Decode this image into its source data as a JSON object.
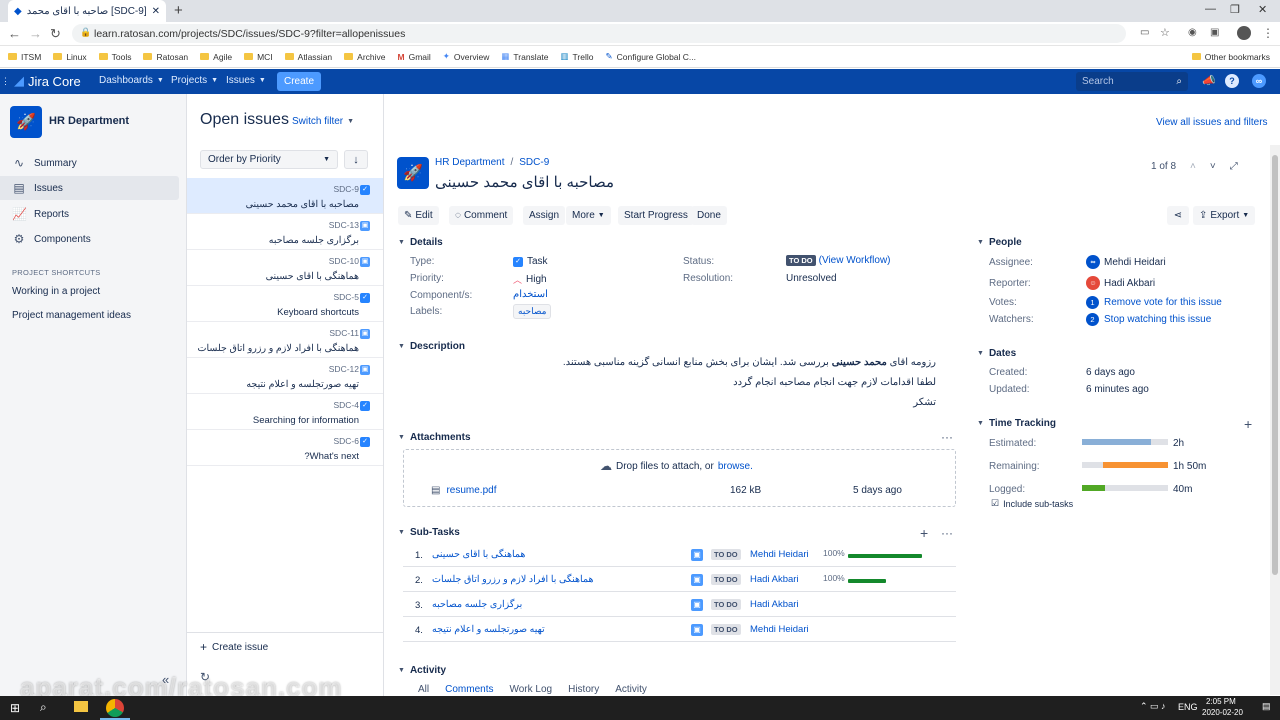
{
  "browser": {
    "tab_title": "[SDC-9] صاحبه با اقای محمد حسینی",
    "url": "learn.ratosan.com/projects/SDC/issues/SDC-9?filter=allopenissues",
    "bookmarks": [
      "ITSM",
      "Linux",
      "Tools",
      "Ratosan",
      "Agile",
      "MCI",
      "Atlassian",
      "Archive",
      "Gmail",
      "Overview",
      "Translate",
      "Trello",
      "Configure Global C..."
    ],
    "other_bookmarks": "Other bookmarks"
  },
  "jira_nav": {
    "logo": "Jira Core",
    "menus": [
      "Dashboards",
      "Projects",
      "Issues"
    ],
    "create": "Create",
    "search_placeholder": "Search"
  },
  "sidebar": {
    "project_name": "HR Department",
    "items": [
      {
        "label": "Summary",
        "icon": "pulse-icon"
      },
      {
        "label": "Issues",
        "icon": "issues-icon",
        "active": true
      },
      {
        "label": "Reports",
        "icon": "chart-icon"
      },
      {
        "label": "Components",
        "icon": "puzzle-icon"
      }
    ],
    "shortcuts_heading": "PROJECT SHORTCUTS",
    "shortcuts": [
      "Working in a project",
      "Project management ideas"
    ]
  },
  "issue_list": {
    "title": "Open issues",
    "switch_filter": "Switch filter",
    "order_by": "Order by Priority",
    "create_issue": "Create issue",
    "view_all": "View all issues and filters",
    "items": [
      {
        "key": "SDC-9",
        "summary": "مصاحبه با اقای محمد حسینی",
        "type": "task"
      },
      {
        "key": "SDC-13",
        "summary": "برگزاری جلسه مصاحبه",
        "type": "subtask"
      },
      {
        "key": "SDC-10",
        "summary": "هماهنگی با اقای حسینی",
        "type": "subtask"
      },
      {
        "key": "SDC-5",
        "summary": "Keyboard shortcuts",
        "type": "task"
      },
      {
        "key": "SDC-11",
        "summary": "هماهنگی با افراد لازم و رزرو اتاق جلسات",
        "type": "subtask"
      },
      {
        "key": "SDC-12",
        "summary": "تهیه صورتجلسه و اعلام نتیجه",
        "type": "subtask"
      },
      {
        "key": "SDC-4",
        "summary": "Searching for information",
        "type": "task"
      },
      {
        "key": "SDC-6",
        "summary": "?What's next",
        "type": "task"
      }
    ]
  },
  "issue": {
    "project": "HR Department",
    "key": "SDC-9",
    "title": "مصاحبه با اقای محمد حسینی",
    "pager": "1 of 8",
    "buttons": {
      "edit": "Edit",
      "comment": "Comment",
      "assign": "Assign",
      "more": "More",
      "start": "Start Progress",
      "done": "Done",
      "export": "Export"
    },
    "details": {
      "heading": "Details",
      "type_label": "Type:",
      "type": "Task",
      "priority_label": "Priority:",
      "priority": "High",
      "component_label": "Component/s:",
      "component": "استخدام",
      "labels_label": "Labels:",
      "labels": "مصاحبه",
      "status_label": "Status:",
      "status": "TO DO",
      "workflow": "(View Workflow)",
      "resolution_label": "Resolution:",
      "resolution": "Unresolved"
    },
    "description": {
      "heading": "Description",
      "line1_pre": "رزومه اقای ",
      "line1_bold": "محمد حسینی",
      "line1_post": " بررسی شد. ایشان برای بخش منابع انسانی گزینه مناسبی هستند.",
      "line2": "لطفا اقدامات لازم جهت انجام مصاحبه انجام گردد",
      "line3": "تشکر"
    },
    "attachments": {
      "heading": "Attachments",
      "drop_text": "Drop files to attach, or",
      "browse": "browse.",
      "file_name": "resume.pdf",
      "file_size": "162 kB",
      "file_date": "5 days ago"
    },
    "subtasks": {
      "heading": "Sub-Tasks",
      "items": [
        {
          "n": "1.",
          "summary": "هماهنگی با اقای حسینی",
          "status": "TO DO",
          "assignee": "Mehdi Heidari",
          "percent": "100%",
          "progress": 1.0
        },
        {
          "n": "2.",
          "summary": "هماهنگی با افراد لازم و رزرو اتاق جلسات",
          "status": "TO DO",
          "assignee": "Hadi Akbari",
          "percent": "100%",
          "progress": 1.0
        },
        {
          "n": "3.",
          "summary": "برگزاری جلسه مصاحبه",
          "status": "TO DO",
          "assignee": "Hadi Akbari",
          "percent": "",
          "progress": 0
        },
        {
          "n": "4.",
          "summary": "تهیه صورتجلسه و اعلام نتیجه",
          "status": "TO DO",
          "assignee": "Mehdi Heidari",
          "percent": "",
          "progress": 0
        }
      ]
    },
    "activity": {
      "heading": "Activity",
      "tabs": [
        "All",
        "Comments",
        "Work Log",
        "History",
        "Activity"
      ]
    },
    "people": {
      "heading": "People",
      "assignee_label": "Assignee:",
      "assignee": "Mehdi Heidari",
      "reporter_label": "Reporter:",
      "reporter": "Hadi Akbari",
      "votes_label": "Votes:",
      "votes": "1",
      "votes_link": "Remove vote for this issue",
      "watchers_label": "Watchers:",
      "watchers": "2",
      "watchers_link": "Stop watching this issue"
    },
    "dates": {
      "heading": "Dates",
      "created_label": "Created:",
      "created": "6 days ago",
      "updated_label": "Updated:",
      "updated": "6 minutes ago"
    },
    "time_tracking": {
      "heading": "Time Tracking",
      "estimated_label": "Estimated:",
      "estimated": "2h",
      "estimated_fill": 0.8,
      "remaining_label": "Remaining:",
      "remaining": "1h 50m",
      "remaining_fill": 0.75,
      "logged_label": "Logged:",
      "logged": "40m",
      "logged_fill": 0.27,
      "include_subtasks": "Include sub-tasks"
    }
  },
  "taskbar": {
    "lang": "ENG",
    "time": "2:05 PM",
    "date": "2020-02-20"
  },
  "watermark": "aparat.com/ratosan.com",
  "colors": {
    "nav": "#0747a6",
    "accent": "#0052cc",
    "progress": "#14892c",
    "remaining": "#f79232",
    "estimated": "#89afd7"
  }
}
